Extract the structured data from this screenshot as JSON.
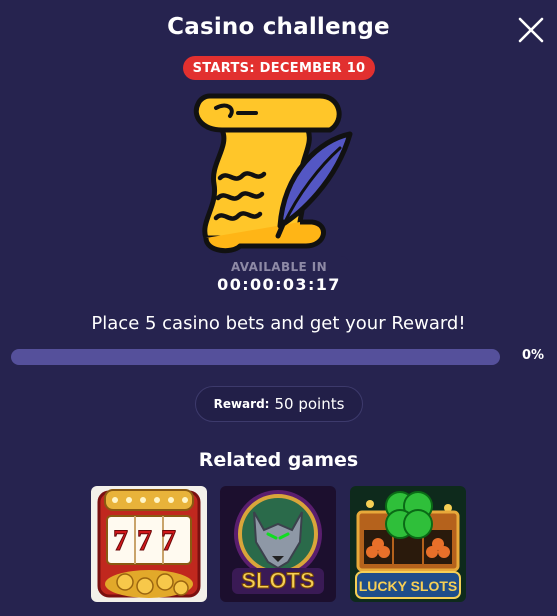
{
  "modal": {
    "title": "Casino challenge",
    "close_icon": "close-icon"
  },
  "badge": {
    "text": "STARTS: DECEMBER 10",
    "color": "#e2302f"
  },
  "hero_icon": "scroll-quill-icon",
  "availability": {
    "label": "AVAILABLE IN",
    "countdown": "00:00:03:17"
  },
  "task": {
    "description": "Place 5 casino bets and get your Reward!",
    "progress_text": "0%",
    "progress_fraction": 0
  },
  "reward": {
    "label": "Reward:",
    "value": "50 points"
  },
  "related": {
    "title": "Related games",
    "games": [
      {
        "name": "777 slot machine",
        "text": "777"
      },
      {
        "name": "Wolf slots",
        "text": "SLOTS"
      },
      {
        "name": "Lucky slots",
        "text": "LUCKY SLOTS"
      }
    ]
  },
  "colors": {
    "background": "#26234f",
    "progress_track": "#55509b",
    "accent_red": "#e2302f",
    "scroll_yellow": "#ffc629"
  }
}
